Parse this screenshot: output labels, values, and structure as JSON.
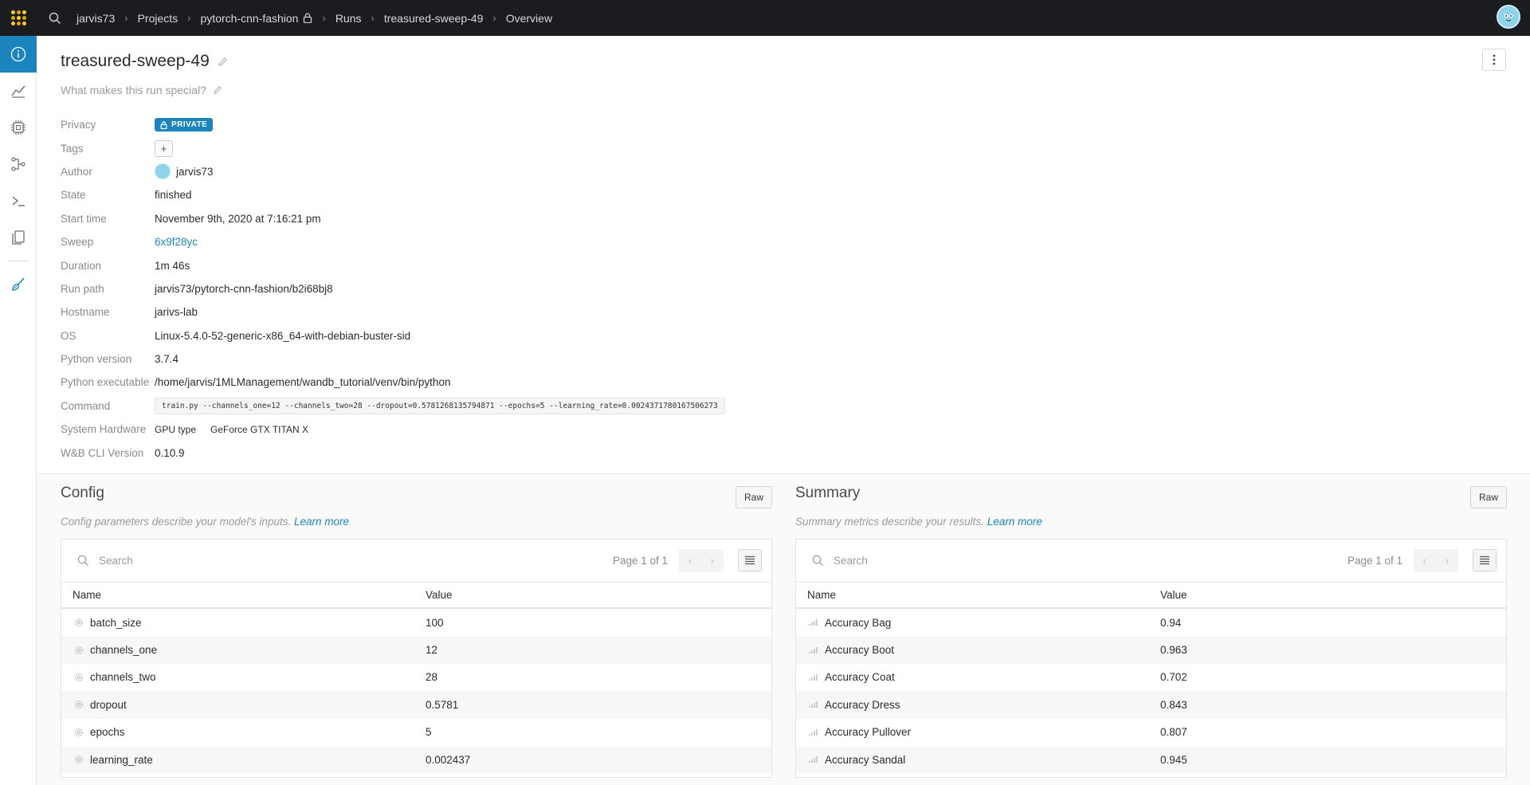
{
  "breadcrumbs": {
    "user": "jarvis73",
    "projects": "Projects",
    "project": "pytorch-cnn-fashion",
    "runs": "Runs",
    "run": "treasured-sweep-49",
    "page": "Overview"
  },
  "run": {
    "title": "treasured-sweep-49",
    "description_placeholder": "What makes this run special?"
  },
  "properties": {
    "privacy_label": "Privacy",
    "privacy_value": "PRIVATE",
    "tags_label": "Tags",
    "tags_add": "+",
    "author_label": "Author",
    "author_value": "jarvis73",
    "state_label": "State",
    "state_value": "finished",
    "start_label": "Start time",
    "start_value": "November 9th, 2020 at 7:16:21 pm",
    "sweep_label": "Sweep",
    "sweep_value": "6x9f28yc",
    "duration_label": "Duration",
    "duration_value": "1m 46s",
    "runpath_label": "Run path",
    "runpath_value": "jarvis73/pytorch-cnn-fashion/b2i68bj8",
    "hostname_label": "Hostname",
    "hostname_value": "jarivs-lab",
    "os_label": "OS",
    "os_value": "Linux-5.4.0-52-generic-x86_64-with-debian-buster-sid",
    "pyver_label": "Python version",
    "pyver_value": "3.7.4",
    "pyexec_label": "Python executable",
    "pyexec_value": "/home/jarvis/1MLManagement/wandb_tutorial/venv/bin/python",
    "command_label": "Command",
    "command_value": "train.py --channels_one=12 --channels_two=28 --dropout=0.5781268135794871 --epochs=5 --learning_rate=0.0024371780167506273",
    "hw_label": "System Hardware",
    "hw_type": "GPU type",
    "hw_value": "GeForce GTX TITAN X",
    "cli_label": "W&B CLI Version",
    "cli_value": "0.10.9"
  },
  "config": {
    "title": "Config",
    "raw": "Raw",
    "desc": "Config parameters describe your model's inputs.",
    "learn_more": "Learn more",
    "search_placeholder": "Search",
    "pager": "Page 1 of 1",
    "col_name": "Name",
    "col_value": "Value",
    "rows": [
      {
        "name": "batch_size",
        "value": "100"
      },
      {
        "name": "channels_one",
        "value": "12"
      },
      {
        "name": "channels_two",
        "value": "28"
      },
      {
        "name": "dropout",
        "value": "0.5781"
      },
      {
        "name": "epochs",
        "value": "5"
      },
      {
        "name": "learning_rate",
        "value": "0.002437"
      }
    ]
  },
  "summary": {
    "title": "Summary",
    "raw": "Raw",
    "desc": "Summary metrics describe your results.",
    "learn_more": "Learn more",
    "search_placeholder": "Search",
    "pager": "Page 1 of 1",
    "col_name": "Name",
    "col_value": "Value",
    "rows": [
      {
        "name": "Accuracy Bag",
        "value": "0.94"
      },
      {
        "name": "Accuracy Boot",
        "value": "0.963"
      },
      {
        "name": "Accuracy Coat",
        "value": "0.702"
      },
      {
        "name": "Accuracy Dress",
        "value": "0.843"
      },
      {
        "name": "Accuracy Pullover",
        "value": "0.807"
      },
      {
        "name": "Accuracy Sandal",
        "value": "0.945"
      }
    ]
  },
  "colors": {
    "accent": "#1b84bd",
    "topbar": "#1a1c1f",
    "logo": "#ffcc33"
  },
  "icons": {
    "sidebar": [
      "info-icon",
      "chart-icon",
      "system-icon",
      "model-icon",
      "terminal-icon",
      "files-icon",
      "sweep-brush-icon"
    ]
  }
}
